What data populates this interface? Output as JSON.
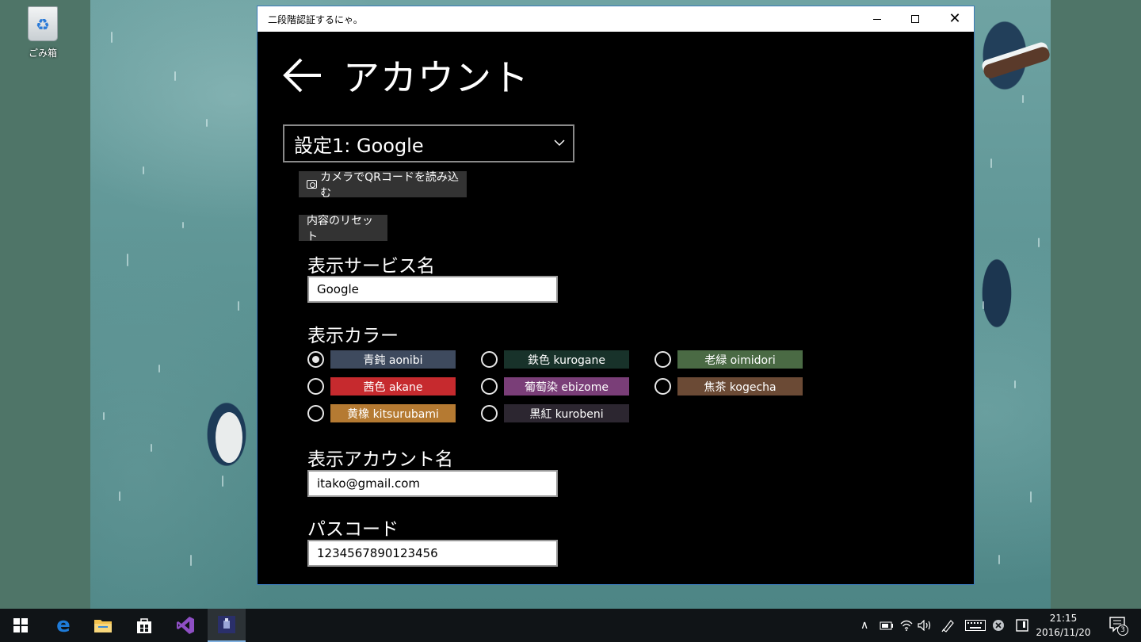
{
  "desktop": {
    "recycle_bin_label": "ごみ箱"
  },
  "window": {
    "title": "二段階認証するにゃ。",
    "page_title": "アカウント",
    "account_select_value": "設定1: Google",
    "qr_button_label": "カメラでQRコードを読み込む",
    "reset_button_label": "内容のリセット",
    "service_name_label": "表示サービス名",
    "service_name_value": "Google",
    "color_label": "表示カラー",
    "colors": [
      {
        "label": "青鈍 aonibi",
        "color": "#3e4a5e",
        "checked": true
      },
      {
        "label": "鉄色 kurogane",
        "color": "#18322a",
        "checked": false
      },
      {
        "label": "老緑 oimidori",
        "color": "#4a6a44",
        "checked": false
      },
      {
        "label": "茜色 akane",
        "color": "#c62a2e",
        "checked": false
      },
      {
        "label": "葡萄染 ebizome",
        "color": "#7a3e78",
        "checked": false
      },
      {
        "label": "焦茶 kogecha",
        "color": "#6b4a35",
        "checked": false
      },
      {
        "label": "黄橡 kitsurubami",
        "color": "#b57a32",
        "checked": false
      },
      {
        "label": "黒紅 kurobeni",
        "color": "#2c2630",
        "checked": false
      }
    ],
    "account_name_label": "表示アカウント名",
    "account_name_value": "itako@gmail.com",
    "passcode_label": "パスコード",
    "passcode_value": "1234567890123456"
  },
  "taskbar": {
    "time": "21:15",
    "date": "2016/11/20",
    "notification_count": "3"
  },
  "colors": {
    "window_border": "#3a79b8",
    "taskbar_bg": "#101417",
    "edge_blue": "#1e7bd8",
    "vs_purple": "#8e4fc4"
  }
}
